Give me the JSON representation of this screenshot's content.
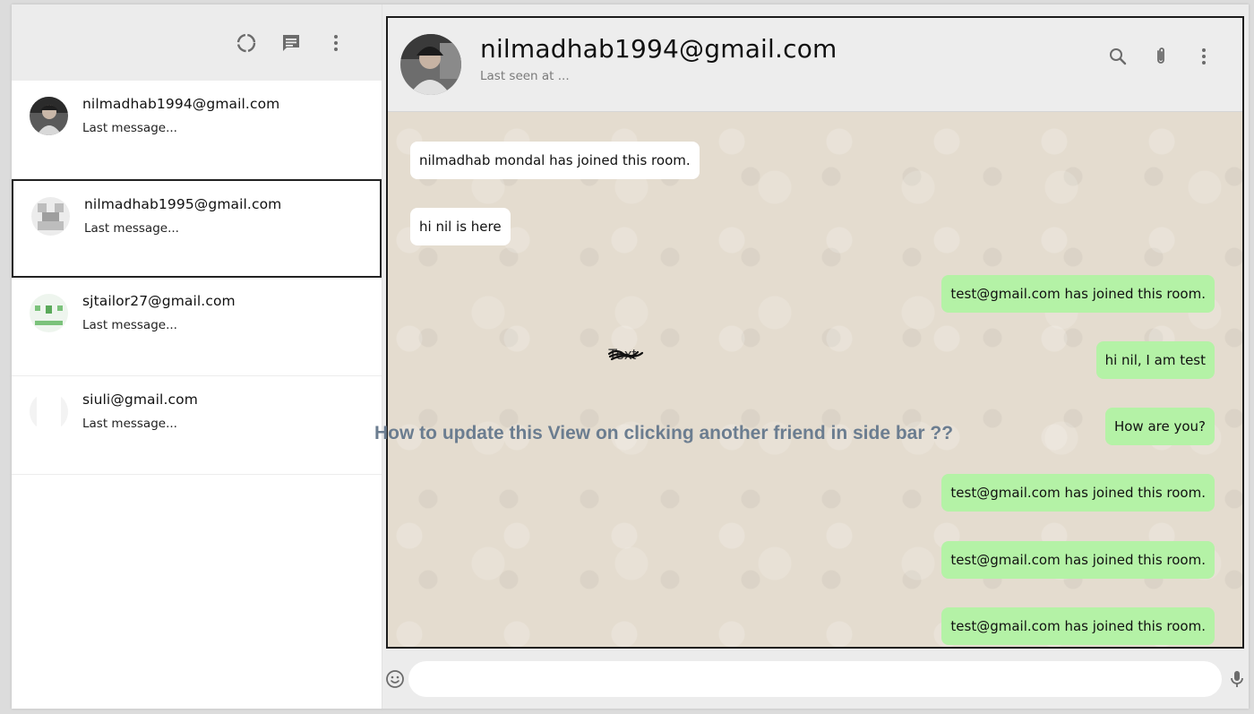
{
  "sidebar": {
    "header_icons": [
      "status-icon",
      "new-chat-icon",
      "more-vert-icon"
    ],
    "chats": [
      {
        "name": "nilmadhab1994@gmail.com",
        "last_message": "Last message..."
      },
      {
        "name": "nilmadhab1995@gmail.com",
        "last_message": "Last message..."
      },
      {
        "name": "sjtailor27@gmail.com",
        "last_message": "Last message..."
      },
      {
        "name": "siuli@gmail.com",
        "last_message": "Last message..."
      }
    ]
  },
  "chat": {
    "name": "nilmadhab1994@gmail.com",
    "status": "Last seen at ...",
    "header_icons": [
      "search-icon",
      "attach-icon",
      "more-vert-icon"
    ],
    "messages": [
      {
        "text": "nilmadhab mondal has joined this room.",
        "direction": "in"
      },
      {
        "text": "hi nil is here",
        "direction": "in"
      },
      {
        "text": "test@gmail.com has joined this room.",
        "direction": "out"
      },
      {
        "text": "hi nil, I am test",
        "direction": "out"
      },
      {
        "text": "How are you?",
        "direction": "out"
      },
      {
        "text": "test@gmail.com has joined this room.",
        "direction": "out"
      },
      {
        "text": "test@gmail.com has joined this room.",
        "direction": "out"
      },
      {
        "text": "test@gmail.com has joined this room.",
        "direction": "out"
      }
    ],
    "input": {
      "value": "",
      "placeholder": ""
    }
  },
  "annotation": {
    "question": "How to update this View on clicking another friend in side bar ??",
    "scribble_label": "Text"
  },
  "colors": {
    "sent_bubble": "#b4f2a6",
    "received_bubble": "#ffffff",
    "chat_background": "#e4dccf",
    "header_background": "#ededed"
  }
}
